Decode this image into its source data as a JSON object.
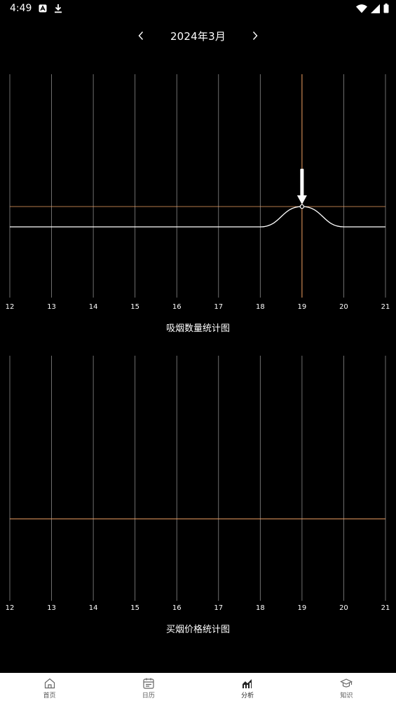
{
  "status": {
    "time": "4:49"
  },
  "header": {
    "month_title": "2024年3月"
  },
  "colors": {
    "accent": "#f2a263",
    "grid": "#8a8a8a",
    "line": "#ffffff"
  },
  "charts": [
    {
      "caption": "吸烟数量统计图"
    },
    {
      "caption": "买烟价格统计图"
    }
  ],
  "chart_data": [
    {
      "type": "line",
      "title": "吸烟数量统计图",
      "x": [
        12,
        13,
        14,
        15,
        16,
        17,
        18,
        19,
        20,
        21
      ],
      "series": [
        {
          "values": [
            0,
            0,
            0,
            0,
            0,
            0,
            0,
            1,
            0,
            0
          ]
        }
      ],
      "highlight_x": 19,
      "grid": true
    },
    {
      "type": "line",
      "title": "买烟价格统计图",
      "x": [
        12,
        13,
        14,
        15,
        16,
        17,
        18,
        19,
        20,
        21
      ],
      "series": [
        {
          "values": [
            0,
            0,
            0,
            0,
            0,
            0,
            0,
            0,
            0,
            0
          ]
        }
      ],
      "grid": true
    }
  ],
  "bottom_nav": [
    {
      "label": "首页",
      "icon": "home-icon"
    },
    {
      "label": "日历",
      "icon": "calendar-icon"
    },
    {
      "label": "分析",
      "icon": "analysis-icon"
    },
    {
      "label": "知识",
      "icon": "knowledge-icon"
    }
  ]
}
